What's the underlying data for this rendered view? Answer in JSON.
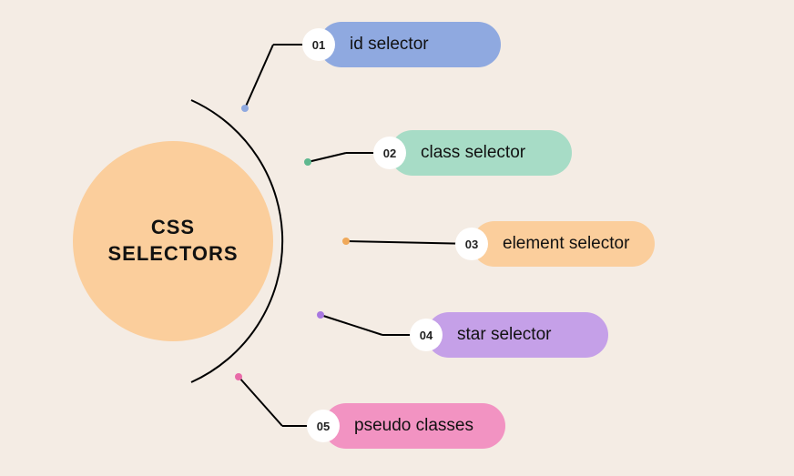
{
  "center": {
    "title": "CSS\nSELECTORS"
  },
  "branches": [
    {
      "num": "01",
      "label": "id selector",
      "color": "#8fa9e0",
      "dot": "#8fa9e0"
    },
    {
      "num": "02",
      "label": "class selector",
      "color": "#a7dcc6",
      "dot": "#5fb88f"
    },
    {
      "num": "03",
      "label": "element selector",
      "color": "#fbce9c",
      "dot": "#f0a95a"
    },
    {
      "num": "04",
      "label": "star selector",
      "color": "#c5a0e8",
      "dot": "#a878e0"
    },
    {
      "num": "05",
      "label": "pseudo classes",
      "color": "#f293c2",
      "dot": "#e86aa8"
    }
  ]
}
